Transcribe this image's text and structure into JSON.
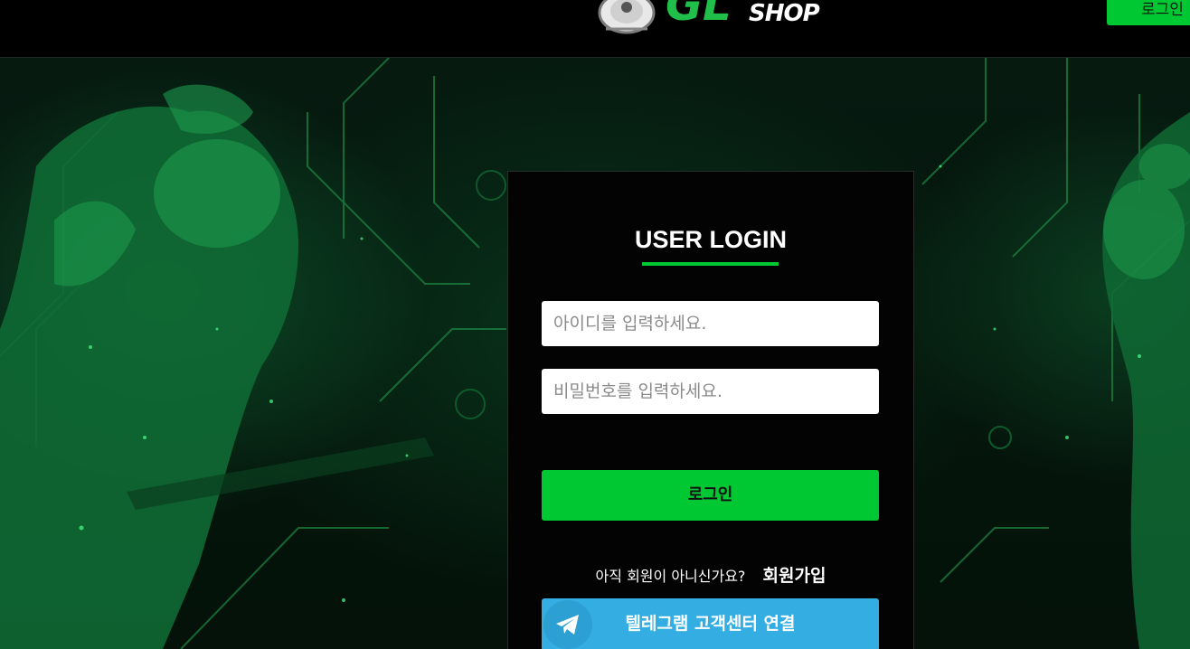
{
  "header": {
    "logo_text": "GL",
    "logo_shop": "SHOP",
    "login_button": "로그인"
  },
  "login_panel": {
    "title": "USER LOGIN",
    "id_placeholder": "아이디를 입력하세요.",
    "password_placeholder": "비밀번호를 입력하세요.",
    "login_button": "로그인",
    "signup_question": "아직 회원이 아니신가요?",
    "signup_link": "회원가입",
    "telegram_button": "텔레그램 고객센터 연결"
  },
  "colors": {
    "accent": "#00c832",
    "telegram": "#34ade2",
    "background": "#000000"
  },
  "icons": [
    "logo-emblem-icon",
    "telegram-icon"
  ]
}
